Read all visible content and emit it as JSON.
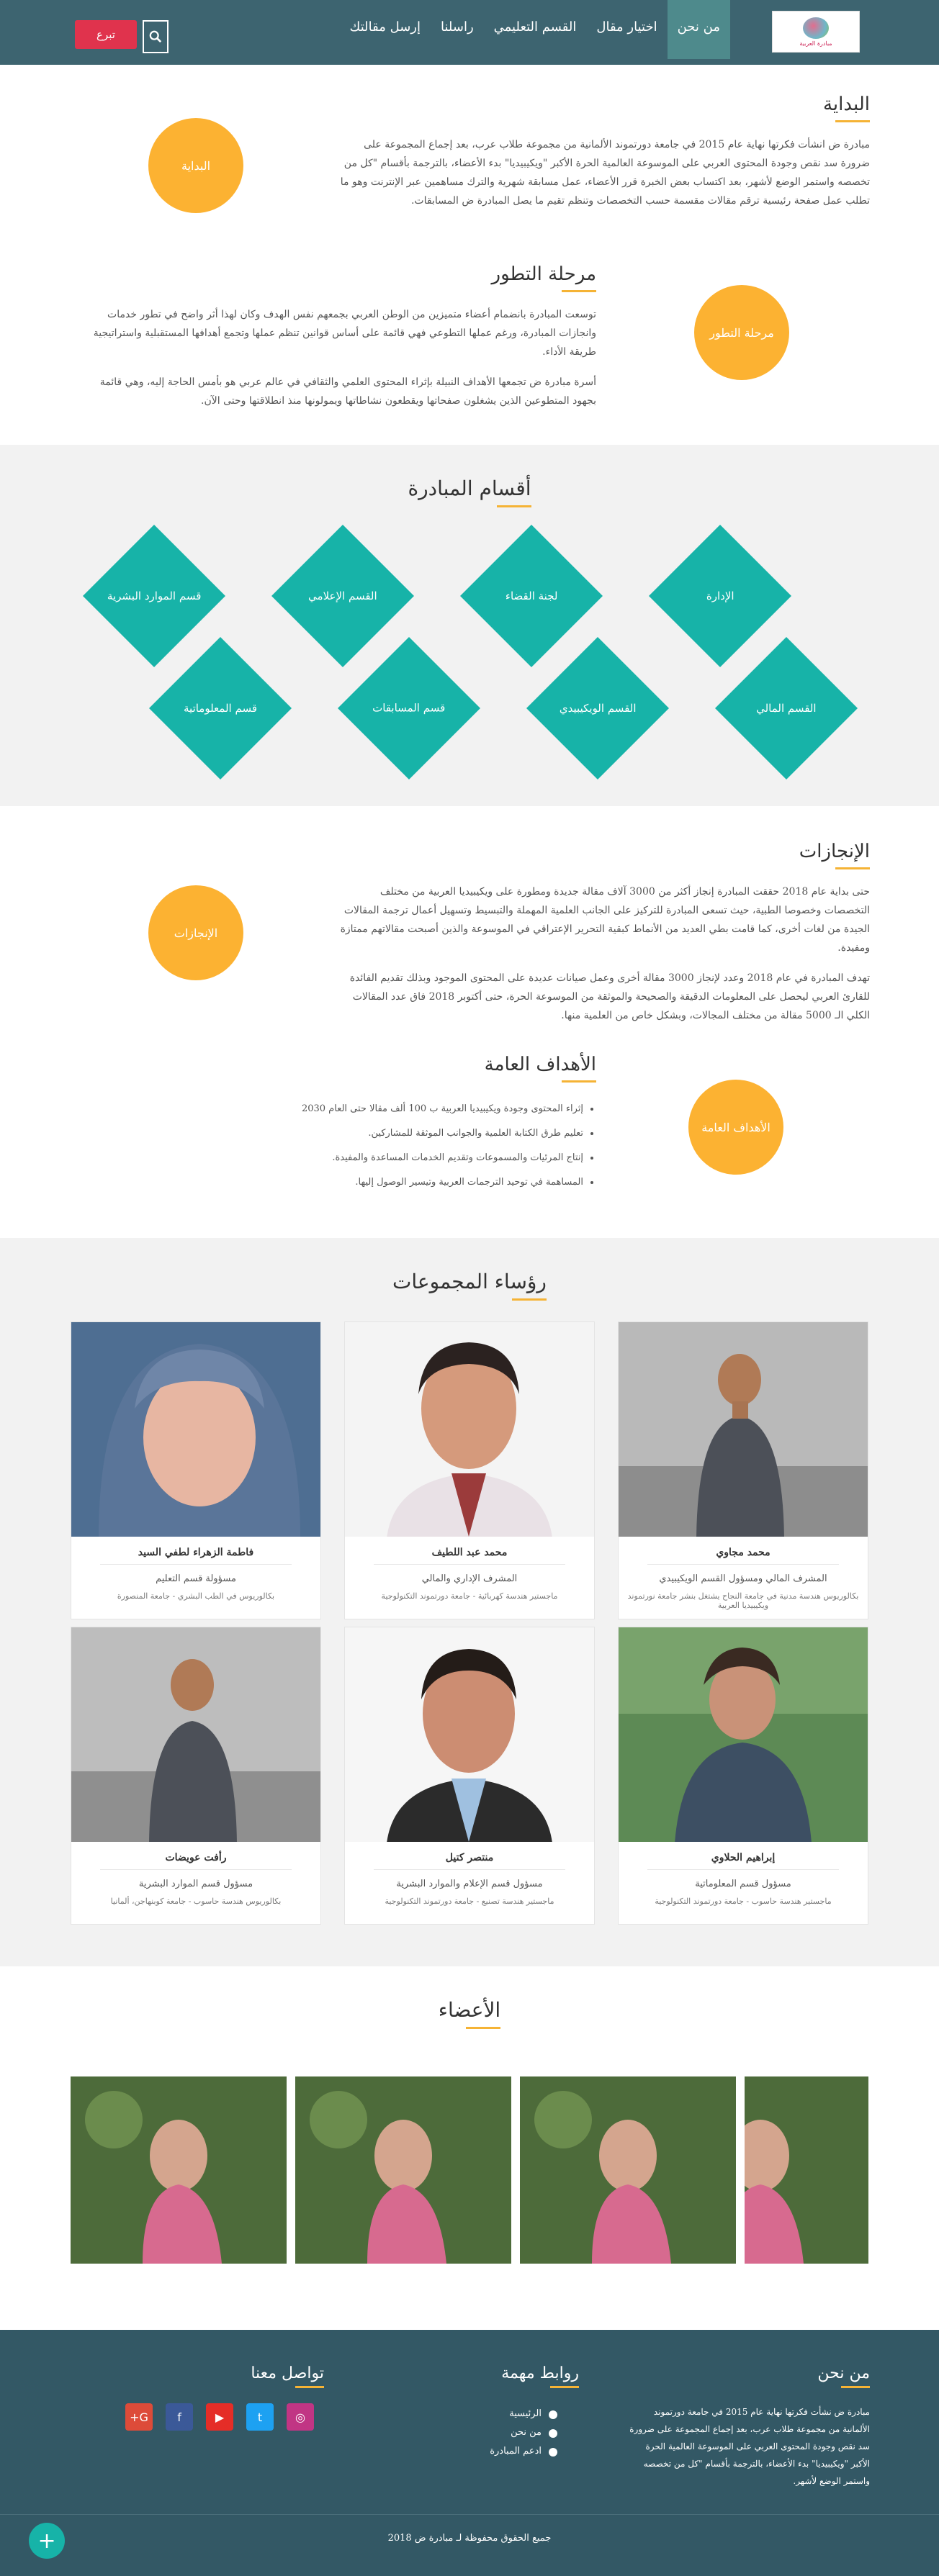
{
  "nav": {
    "logo_text": "مبادرة العربية",
    "items": [
      "من نحن",
      "اختيار مقال",
      "القسم التعليمي",
      "راسلنا",
      "إرسل مقالتك"
    ],
    "join": "تبرع"
  },
  "about": {
    "start": {
      "title": "البداية",
      "circle": "البداية",
      "text": "مبادرة ض انشأت فكرتها نهاية عام 2015 في جامعة دورتموند الألمانية من مجموعة طلاب عرب، بعد إجماع المجموعة على ضرورة سد نقص وجودة المحتوى العربي على الموسوعة العالمية الحرة الأكبر \"ويكيبيديا\" بدء الأعضاء، بالترجمة بأقسام \"كل من تخصصه واستمر الوضع لأشهر، بعد اكتساب بعض الخبرة قرر الأعضاء، عمل مسابقة شهرية والترك مساهمين عبر الإنترنت وهو ما تطلب عمل صفحة رئيسية ترقم مقالات مقسمة حسب التخصصات وتنظم تقيم ما يصل المبادرة ض المسابقات."
    },
    "growth": {
      "title": "مرحلة التطور",
      "circle": "مرحلة التطور",
      "text1": "توسعت المبادرة بانضمام أعضاء متميزين من الوطن العربي بجمعهم نفس الهدف وكان لهذا أثر واضح في تطور خدمات وانجازات المبادرة، ورغم عملها التطوعي فهي قائمة على أساس قوانين تنظم عملها وتجمع أهدافها المستقبلية واستراتيجية طريقة الأداء.",
      "text2": "أسرة مبادرة ض تجمعها الأهداف النبيلة بإثراء المحتوى العلمي والثقافي في عالم عربي هو بأمس الحاجة إليه، وهي قائمة بجهود المتطوعين الذين يشغلون صفحاتها ويقطعون نشاطاتها ويمولونها منذ انطلاقتها وحتى الآن."
    }
  },
  "departments": {
    "title": "أقسام المبادرة",
    "items": [
      "الإدارة",
      "لجنة القضاء",
      "القسم الإعلامي",
      "قسم الموارد البشرية",
      "القسم المالي",
      "القسم الويكيبيدي",
      "قسم المسابقات",
      "قسم المعلوماتية"
    ]
  },
  "achievements": {
    "title": "الإنجازات",
    "circle": "الإنجازات",
    "text1": "حتى بداية عام 2018 حققت المبادرة إنجاز أكثر من 3000 آلاف مقالة جديدة ومطورة على ويكيبيديا العربية من مختلف التخصصات وخصوصا الطبية، حيث تسعى المبادرة للتركيز على الجانب العلمية المهملة والتبسيط وتسهيل أعمال ترجمة المقالات الجيدة من لغات أخرى، كما قامت بطي العديد من الأنماط كبقية التحرير الإعتراقي في الموسوعة والذين أصبحت مقالاتهم ممتازة ومفيدة.",
    "text2": "تهدف المبادرة في عام 2018 وعدد لإنجاز 3000 مقالة أخرى وعمل صيانات عديدة على المحتوى الموجود وبذلك تقديم الفائدة للقارئ العربي ليحصل على المعلومات الدقيقة والصحيحة والموثقة من الموسوعة الحرة، حتى أكتوبر 2018 فاق عدد المقالات الكلي الـ 5000 مقالة من مختلف المجالات، وبشكل خاص من العلمية منها."
  },
  "goals": {
    "title": "الأهداف العامة",
    "circle": "الأهداف العامة",
    "items": [
      "إثراء المحتوى وجودة ويكيبيديا العربية ب 100 ألف مقالا حتى العام 2030",
      "تعليم طرق الكتابة العلمية والجوانب الموثقة للمشاركين.",
      "إنتاج المرئيات والمسموعات وتقديم الخدمات المساعدة والمفيدة.",
      "المساهمة في توحيد الترجمات العربية وتيسير الوصول إليها."
    ]
  },
  "heads": {
    "title": "رؤساء المجموعات",
    "cards": [
      {
        "name": "محمد مجاوي",
        "role": "المشرف المالي ومسؤول القسم الويكيبيدي",
        "edu": "بكالوريوس هندسة مدنية في جامعة النجاح يشتغل بنشر جامعة نورتموند ويكيبيديا العربية"
      },
      {
        "name": "محمد عبد اللطيف",
        "role": "المشرف الإداري والمالي",
        "edu": "ماجستير هندسة كهربائية - جامعة دورتموند التكنولوجية"
      },
      {
        "name": "فاطمة الزهراء لطفي السيد",
        "role": "مسؤولة قسم التعليم",
        "edu": "بكالوريوس في الطب البشري - جامعة المنصورة"
      },
      {
        "name": "إبراهيم الحلاوي",
        "role": "مسؤول قسم المعلوماتية",
        "edu": "ماجستير هندسة حاسوب - جامعة دورتموند التكنولوجية"
      },
      {
        "name": "منتصر كتيل",
        "role": "مسؤول قسم الإعلام والموارد البشرية",
        "edu": "ماجستير هندسة تصنيع - جامعة دورتموند التكنولوجية"
      },
      {
        "name": "رأفت عويضات",
        "role": "مسؤول قسم الموارد البشرية",
        "edu": "بكالوريوس هندسة حاسوب - جامعة كوبنهاجن، ألمانيا"
      }
    ]
  },
  "members": {
    "title": "الأعضاء"
  },
  "footer": {
    "about_title": "من نحن",
    "about_text": "مبادرة ض نشأت فكرتها نهاية عام 2015 في جامعة دورتموند الألمانية من مجموعة طلاب عرب، بعد إجماع المجموعة على ضرورة سد نقص وجودة المحتوى العربي على الموسوعة العالمية الحرة الأكبر \"ويكيبيديا\" بدء الأعضاء، بالترجمة بأقسام \"كل من تخصصه واستمر الوضع لأشهر.",
    "links_title": "روابط مهمة",
    "links": [
      "الرئيسية",
      "من نحن",
      "ادعم المبادرة"
    ],
    "contact_title": "تواصل معنا",
    "copyright": "جميع الحقوق محفوظة لـ مبادرة ض 2018",
    "social": [
      {
        "icon": "instagram-icon",
        "glyph": "◎",
        "color": "#c13584"
      },
      {
        "icon": "twitter-icon",
        "glyph": "t",
        "color": "#1da1f2"
      },
      {
        "icon": "youtube-icon",
        "glyph": "▶",
        "color": "#e52d27"
      },
      {
        "icon": "facebook-icon",
        "glyph": "f",
        "color": "#3b5998"
      },
      {
        "icon": "google-plus-icon",
        "glyph": "G+",
        "color": "#dd4b39"
      }
    ]
  }
}
